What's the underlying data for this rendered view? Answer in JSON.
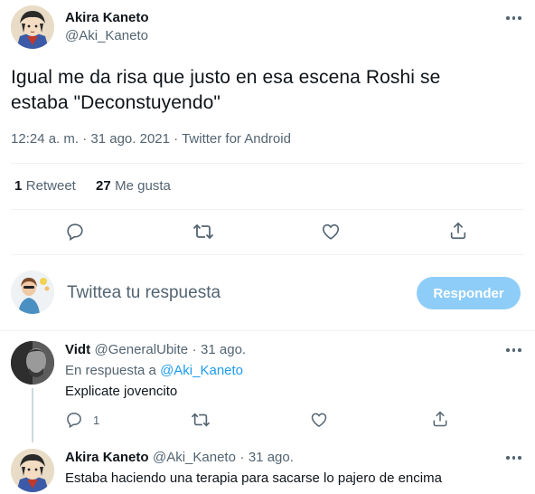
{
  "main_tweet": {
    "author_name": "Akira Kaneto",
    "author_handle": "@Aki_Kaneto",
    "text_line1": "Igual me da risa que justo en esa escena Roshi se",
    "text_line2": "estaba \"Deconstuyendo\"",
    "time": "12:24 a. m.",
    "sep1": "·",
    "date": "31 ago. 2021",
    "sep2": "·",
    "client": "Twitter for Android",
    "retweets_count": "1",
    "retweets_label": "Retweet",
    "likes_count": "27",
    "likes_label": "Me gusta"
  },
  "actions": {
    "reply_icon": "reply-icon",
    "retweet_icon": "retweet-icon",
    "like_icon": "heart-icon",
    "share_icon": "share-icon"
  },
  "composer": {
    "placeholder": "Twittea tu respuesta",
    "button_label": "Responder"
  },
  "replies": [
    {
      "name": "Vidt",
      "handle": "@GeneralUbite",
      "sep": "·",
      "date": "31 ago.",
      "in_reply_prefix": "En respuesta a",
      "in_reply_to": "@Aki_Kaneto",
      "text": "Explicate jovencito",
      "reply_count": "1"
    },
    {
      "name": "Akira Kaneto",
      "handle": "@Aki_Kaneto",
      "sep": "·",
      "date": "31 ago.",
      "text": "Estaba haciendo una terapia para sacarse lo pajero de encima"
    }
  ],
  "colors": {
    "accent": "#1d9bf0",
    "button_disabled": "#8ecdf8",
    "muted": "#536471",
    "divider": "#eff3f4"
  }
}
